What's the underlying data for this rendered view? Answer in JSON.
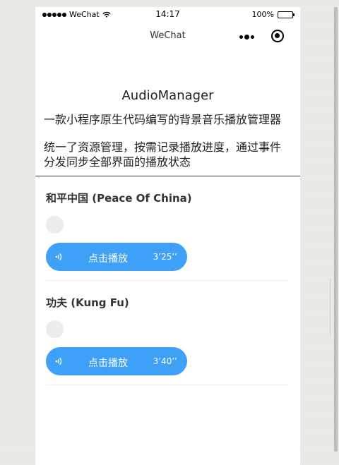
{
  "status_bar": {
    "carrier": "WeChat",
    "time": "14:17",
    "battery_text": "100%",
    "battery_level": 1.0
  },
  "nav": {
    "title": "WeChat",
    "more_icon": "more-dots-icon",
    "close_icon": "target-close-icon"
  },
  "header": {
    "title": "AudioManager",
    "desc1": "一款小程序原生代码编写的背景音乐播放管理器",
    "desc2": "统一了资源管理，按需记录播放进度，通过事件分发同步全部界面的播放状态"
  },
  "tracks": [
    {
      "title": "和平中国 (Peace Of China)",
      "play_label": "点击播放",
      "duration": "3’25’’"
    },
    {
      "title": "功夫 (Kung Fu)",
      "play_label": "点击播放",
      "duration": "3’40’’"
    }
  ],
  "colors": {
    "accent": "#3fa0f7",
    "disc": "#ececec",
    "background": "#ecebe8"
  }
}
